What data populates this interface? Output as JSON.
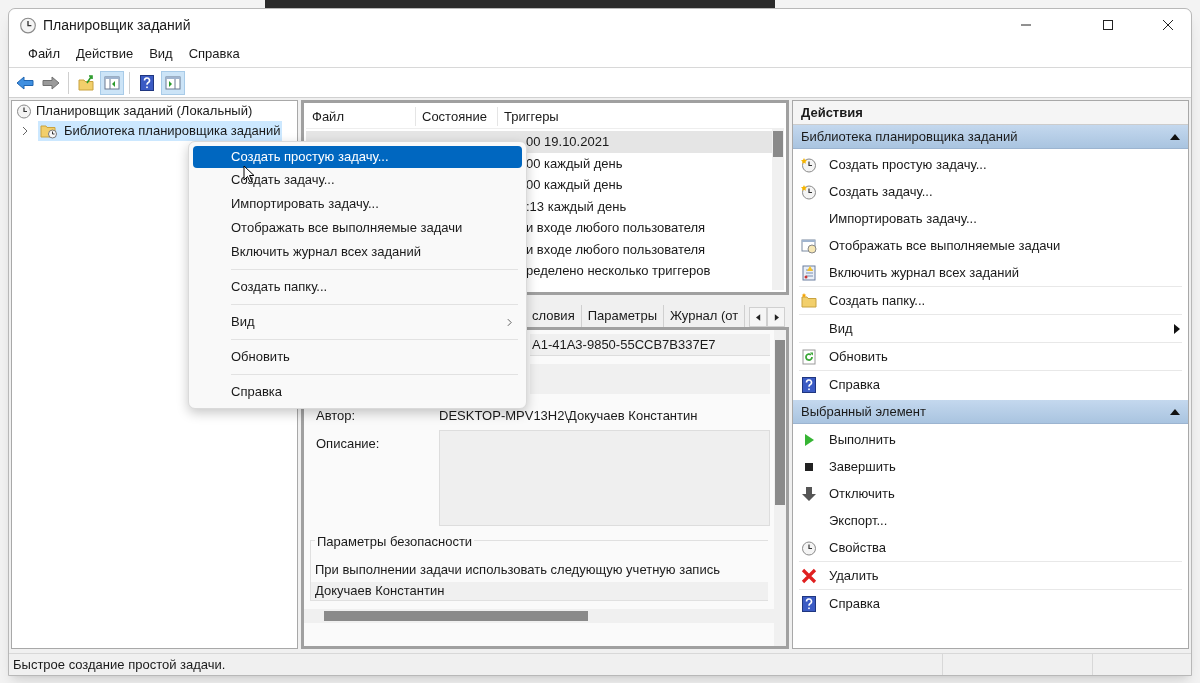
{
  "window": {
    "title": "Планировщик заданий"
  },
  "menu_bar": [
    "Файл",
    "Действие",
    "Вид",
    "Справка"
  ],
  "toolbar": [
    {
      "kind": "back",
      "pressed": false
    },
    {
      "kind": "forward",
      "pressed": false
    },
    {
      "kind": "folder-up",
      "pressed": false
    },
    {
      "kind": "tree-pane",
      "pressed": true
    },
    {
      "kind": "help",
      "pressed": false
    },
    {
      "kind": "action-pane",
      "pressed": true
    }
  ],
  "tree": [
    {
      "label": "Планировщик заданий (Локальный)",
      "selected": false,
      "children": [
        {
          "label": "Библиотека планировщика заданий",
          "selected": true,
          "expanded": false
        }
      ]
    }
  ],
  "context_menu": [
    {
      "label": "Создать простую задачу...",
      "selected": true,
      "submenu": false,
      "separator_after": false
    },
    {
      "label": "Создать задачу...",
      "selected": false,
      "submenu": false,
      "separator_after": false
    },
    {
      "label": "Импортировать задачу...",
      "selected": false,
      "submenu": false,
      "separator_after": false
    },
    {
      "label": "Отображать все выполняемые задачи",
      "selected": false,
      "submenu": false,
      "separator_after": false
    },
    {
      "label": "Включить журнал всех заданий",
      "selected": false,
      "submenu": false,
      "separator_after": true
    },
    {
      "label": "Создать папку...",
      "selected": false,
      "submenu": false,
      "separator_after": true
    },
    {
      "label": "Вид",
      "selected": false,
      "submenu": true,
      "separator_after": true
    },
    {
      "label": "Обновить",
      "selected": false,
      "submenu": false,
      "separator_after": true
    },
    {
      "label": "Справка",
      "selected": false,
      "submenu": false,
      "separator_after": false
    }
  ],
  "task_list": {
    "columns": [
      "Файл",
      "Состояние",
      "Триггеры"
    ],
    "rows": [
      {
        "triggers": "00 19.10.2021",
        "selected": true
      },
      {
        "triggers": "00 каждый день",
        "selected": false
      },
      {
        "triggers": "00 каждый день",
        "selected": false
      },
      {
        "triggers": ":13 каждый день",
        "selected": false
      },
      {
        "triggers": "и входе любого пользователя",
        "selected": false
      },
      {
        "triggers": "и входе любого пользователя",
        "selected": false
      },
      {
        "triggers": "ределено несколько триггеров",
        "selected": false
      }
    ]
  },
  "detail_tabs": [
    {
      "label": "словия",
      "selected": false
    },
    {
      "label": "Параметры",
      "selected": false
    },
    {
      "label": "Журнал (от",
      "selected": false
    }
  ],
  "details": {
    "location": "A1-41A3-9850-55CCB7B337E7",
    "author_label": "Автор:",
    "author": "DESKTOP-MPV13H2\\Докучаев Константин",
    "description_label": "Описание:",
    "security_title": "Параметры безопасности",
    "account_label": "При выполнении задачи использовать следующую учетную запись",
    "account": "Докучаев Константин"
  },
  "actions": {
    "title": "Действия",
    "sections": [
      {
        "title": "Библиотека планировщика заданий",
        "expanded": true,
        "items": [
          {
            "label": "Создать простую задачу...",
            "kind": "wizard",
            "submenu": false,
            "separator_after": false
          },
          {
            "label": "Создать задачу...",
            "kind": "new-task",
            "submenu": false,
            "separator_after": false
          },
          {
            "label": "Импортировать задачу...",
            "kind": "none",
            "submenu": false,
            "separator_after": false
          },
          {
            "label": "Отображать все выполняемые задачи",
            "kind": "running",
            "submenu": false,
            "separator_after": false
          },
          {
            "label": "Включить журнал всех заданий",
            "kind": "log",
            "submenu": false,
            "separator_after": true
          },
          {
            "label": "Создать папку...",
            "kind": "folder",
            "submenu": false,
            "separator_after": true
          },
          {
            "label": "Вид",
            "kind": "none",
            "submenu": true,
            "separator_after": true
          },
          {
            "label": "Обновить",
            "kind": "refresh",
            "submenu": false,
            "separator_after": true
          },
          {
            "label": "Справка",
            "kind": "help",
            "submenu": false,
            "separator_after": false
          }
        ]
      },
      {
        "title": "Выбранный элемент",
        "expanded": true,
        "items": [
          {
            "label": "Выполнить",
            "kind": "run",
            "submenu": false,
            "separator_after": false
          },
          {
            "label": "Завершить",
            "kind": "stop",
            "submenu": false,
            "separator_after": false
          },
          {
            "label": "Отключить",
            "kind": "disable",
            "submenu": false,
            "separator_after": false
          },
          {
            "label": "Экспорт...",
            "kind": "none",
            "submenu": false,
            "separator_after": false
          },
          {
            "label": "Свойства",
            "kind": "properties",
            "submenu": false,
            "separator_after": true
          },
          {
            "label": "Удалить",
            "kind": "delete",
            "submenu": false,
            "separator_after": true
          },
          {
            "label": "Справка",
            "kind": "help",
            "submenu": false,
            "separator_after": false
          }
        ]
      }
    ]
  },
  "status_bar": {
    "text": "Быстрое создание простой задачи."
  }
}
